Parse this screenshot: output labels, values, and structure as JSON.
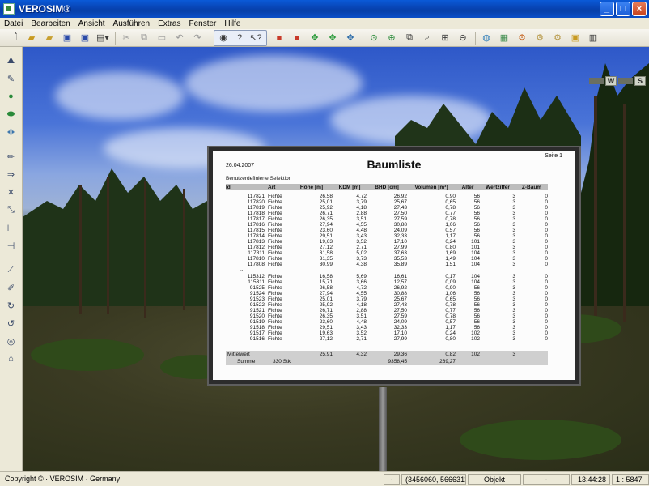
{
  "window": {
    "title": "VEROSIM®"
  },
  "menu": [
    "Datei",
    "Bearbeiten",
    "Ansicht",
    "Ausführen",
    "Extras",
    "Fenster",
    "Hilfe"
  ],
  "compass": {
    "west": "W",
    "south": "S"
  },
  "report": {
    "date": "26.04.2007",
    "title": "Baumliste",
    "page": "Seite 1",
    "subtitle": "Benutzerdefinierte Selektion",
    "columns": [
      "Id",
      "Art",
      "Höhe [m]",
      "KDM [m]",
      "BHD [cm]",
      "Volumen [m³]",
      "Alter",
      "Wertziffer",
      "Z-Baum"
    ],
    "rows_top": [
      [
        "117821",
        "Fichte",
        "26,58",
        "4,72",
        "26,92",
        "0,90",
        "56",
        "3",
        "0"
      ],
      [
        "117820",
        "Fichte",
        "25,01",
        "3,79",
        "25,67",
        "0,65",
        "56",
        "3",
        "0"
      ],
      [
        "117819",
        "Fichte",
        "25,92",
        "4,18",
        "27,43",
        "0,78",
        "56",
        "3",
        "0"
      ],
      [
        "117818",
        "Fichte",
        "26,71",
        "2,88",
        "27,50",
        "0,77",
        "56",
        "3",
        "0"
      ],
      [
        "117817",
        "Fichte",
        "26,35",
        "3,51",
        "27,59",
        "0,78",
        "56",
        "3",
        "0"
      ],
      [
        "117816",
        "Fichte",
        "27,94",
        "4,55",
        "30,88",
        "1,06",
        "56",
        "3",
        "0"
      ],
      [
        "117815",
        "Fichte",
        "23,60",
        "4,48",
        "24,09",
        "0,57",
        "56",
        "3",
        "0"
      ],
      [
        "117814",
        "Fichte",
        "29,51",
        "3,43",
        "32,33",
        "1,17",
        "56",
        "3",
        "0"
      ],
      [
        "117813",
        "Fichte",
        "19,63",
        "3,52",
        "17,10",
        "0,24",
        "101",
        "3",
        "0"
      ],
      [
        "117812",
        "Fichte",
        "27,12",
        "2,71",
        "27,99",
        "0,80",
        "101",
        "3",
        "0"
      ],
      [
        "117811",
        "Fichte",
        "31,58",
        "5,02",
        "37,63",
        "1,69",
        "104",
        "3",
        "0"
      ],
      [
        "117810",
        "Fichte",
        "31,35",
        "3,73",
        "35,53",
        "1,49",
        "104",
        "3",
        "0"
      ],
      [
        "117808",
        "Fichte",
        "30,99",
        "4,38",
        "35,89",
        "1,51",
        "104",
        "3",
        "0"
      ]
    ],
    "ellipsis": "...",
    "rows_bottom": [
      [
        "115312",
        "Fichte",
        "16,58",
        "5,69",
        "16,61",
        "0,17",
        "104",
        "3",
        "0"
      ],
      [
        "115311",
        "Fichte",
        "15,71",
        "3,66",
        "12,57",
        "0,09",
        "104",
        "3",
        "0"
      ],
      [
        "91525",
        "Fichte",
        "26,58",
        "4,72",
        "26,92",
        "0,90",
        "56",
        "3",
        "0"
      ],
      [
        "91524",
        "Fichte",
        "27,94",
        "4,55",
        "30,88",
        "1,06",
        "56",
        "3",
        "0"
      ],
      [
        "91523",
        "Fichte",
        "25,01",
        "3,79",
        "25,67",
        "0,65",
        "56",
        "3",
        "0"
      ],
      [
        "91522",
        "Fichte",
        "25,92",
        "4,18",
        "27,43",
        "0,78",
        "56",
        "3",
        "0"
      ],
      [
        "91521",
        "Fichte",
        "26,71",
        "2,88",
        "27,50",
        "0,77",
        "56",
        "3",
        "0"
      ],
      [
        "91520",
        "Fichte",
        "26,35",
        "3,51",
        "27,59",
        "0,78",
        "56",
        "3",
        "0"
      ],
      [
        "91519",
        "Fichte",
        "23,60",
        "4,48",
        "24,09",
        "0,57",
        "56",
        "3",
        "0"
      ],
      [
        "91518",
        "Fichte",
        "29,51",
        "3,43",
        "32,33",
        "1,17",
        "56",
        "3",
        "0"
      ],
      [
        "91517",
        "Fichte",
        "19,63",
        "3,52",
        "17,10",
        "0,24",
        "102",
        "3",
        "0"
      ],
      [
        "91516",
        "Fichte",
        "27,12",
        "2,71",
        "27,99",
        "0,80",
        "102",
        "3",
        "0"
      ]
    ],
    "mean_label": "Mittelwert",
    "mean_values": [
      "25,91",
      "4,32",
      "29,36",
      "0,82",
      "102",
      "3"
    ],
    "sum_label": "Summe",
    "sum_count": "330 Stk",
    "sum_values": [
      "9358,45",
      "269,27"
    ]
  },
  "status": {
    "copyright": "Copyright © · VEROSIM · Germany",
    "dash": "-",
    "coords": "(3456060, 5666312)",
    "mode": "Objekt",
    "dash2": "-",
    "time": "13:44:28",
    "scale": "1 : 5847"
  }
}
